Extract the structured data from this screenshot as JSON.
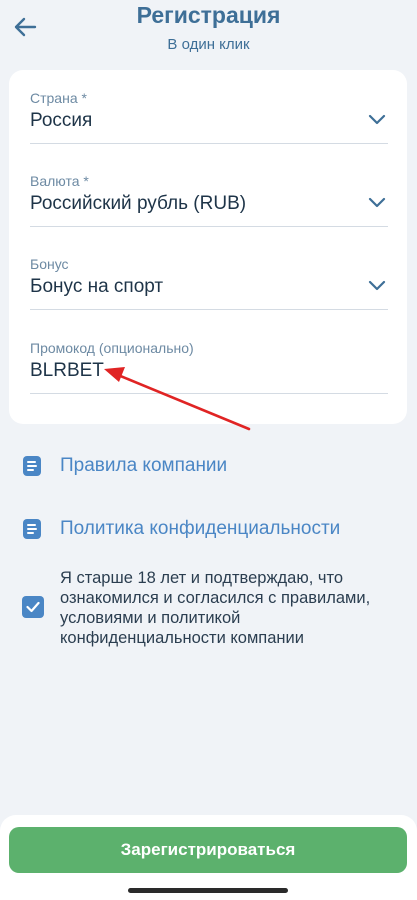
{
  "header": {
    "title": "Регистрация",
    "subtitle": "В один клик"
  },
  "form": {
    "fields": [
      {
        "label": "Страна *",
        "value": "Россия"
      },
      {
        "label": "Валюта *",
        "value": "Российский рубль (RUB)"
      },
      {
        "label": "Бонус",
        "value": "Бонус на спорт"
      },
      {
        "label": "Промокод (опционально)",
        "value": "BLRBET"
      }
    ]
  },
  "links": {
    "rules": "Правила компании",
    "privacy": "Политика конфиденциальности"
  },
  "consent": {
    "checked": true,
    "text": "Я старше 18 лет и подтверждаю, что ознакомился и согласился с правилами, условиями и политикой конфиденциальности компании"
  },
  "footer": {
    "register_label": "Зарегистрироваться"
  },
  "colors": {
    "accent": "#4a86c5",
    "title": "#3e6f97",
    "button": "#5cb16d",
    "annotation_arrow": "#e02424"
  },
  "icons": {
    "back": "arrow-left-icon",
    "dropdown": "chevron-down-icon",
    "document": "document-icon",
    "checkbox": "check-icon"
  }
}
